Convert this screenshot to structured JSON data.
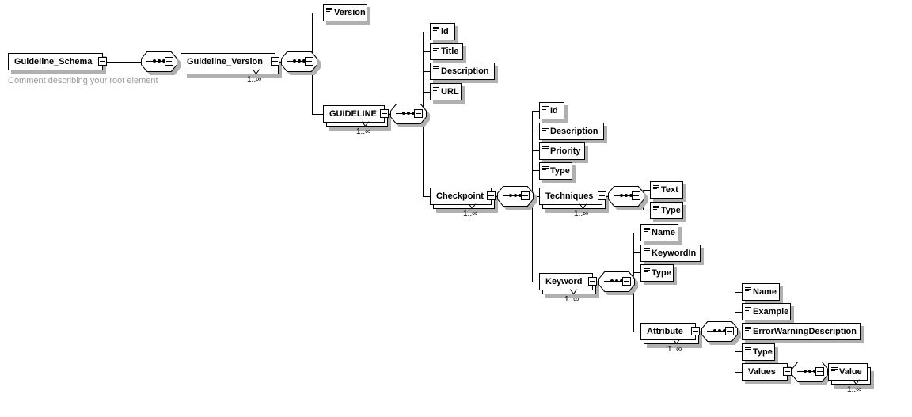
{
  "diagram": {
    "kind": "xml-schema-tree",
    "root_comment": "Comment describing your root element",
    "occurrence_label": "1..∞",
    "colors": {
      "line": "#000000",
      "box_fill": "#ffffff",
      "shadow": "#b0b0b0",
      "comment_text": "#9a9a9a"
    },
    "nodes": {
      "guideline_schema": "Guideline_Schema",
      "guideline_version": "Guideline_Version",
      "version": "Version",
      "guideline": "GUIDELINE",
      "id_1": "Id",
      "title": "Title",
      "description_1": "Description",
      "url": "URL",
      "checkpoint": "Checkpoint",
      "id_2": "Id",
      "description_2": "Description",
      "priority": "Priority",
      "type_1": "Type",
      "techniques": "Techniques",
      "text": "Text",
      "type_2": "Type",
      "keyword": "Keyword",
      "name_1": "Name",
      "keywordin": "KeywordIn",
      "type_3": "Type",
      "attribute": "Attribute",
      "name_2": "Name",
      "example": "Example",
      "errorwarningdescription": "ErrorWarningDescription",
      "type_4": "Type",
      "values": "Values",
      "value": "Value"
    }
  }
}
